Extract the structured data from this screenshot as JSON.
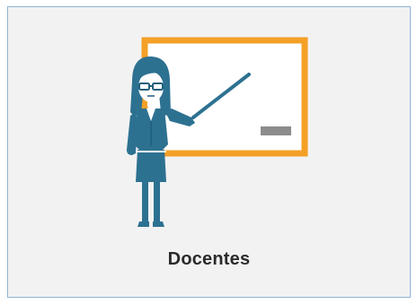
{
  "tile": {
    "label": "Docentes",
    "icon": "teacher-at-whiteboard-icon"
  },
  "colors": {
    "tile_background": "#f2f2f2",
    "tile_border": "#8eb4d6",
    "board_frame": "#f4a026",
    "board_eraser": "#8c8c8c",
    "figure_teal": "#2d7191",
    "figure_dark": "#1f5f7c",
    "label_text": "#2b2b2b"
  }
}
